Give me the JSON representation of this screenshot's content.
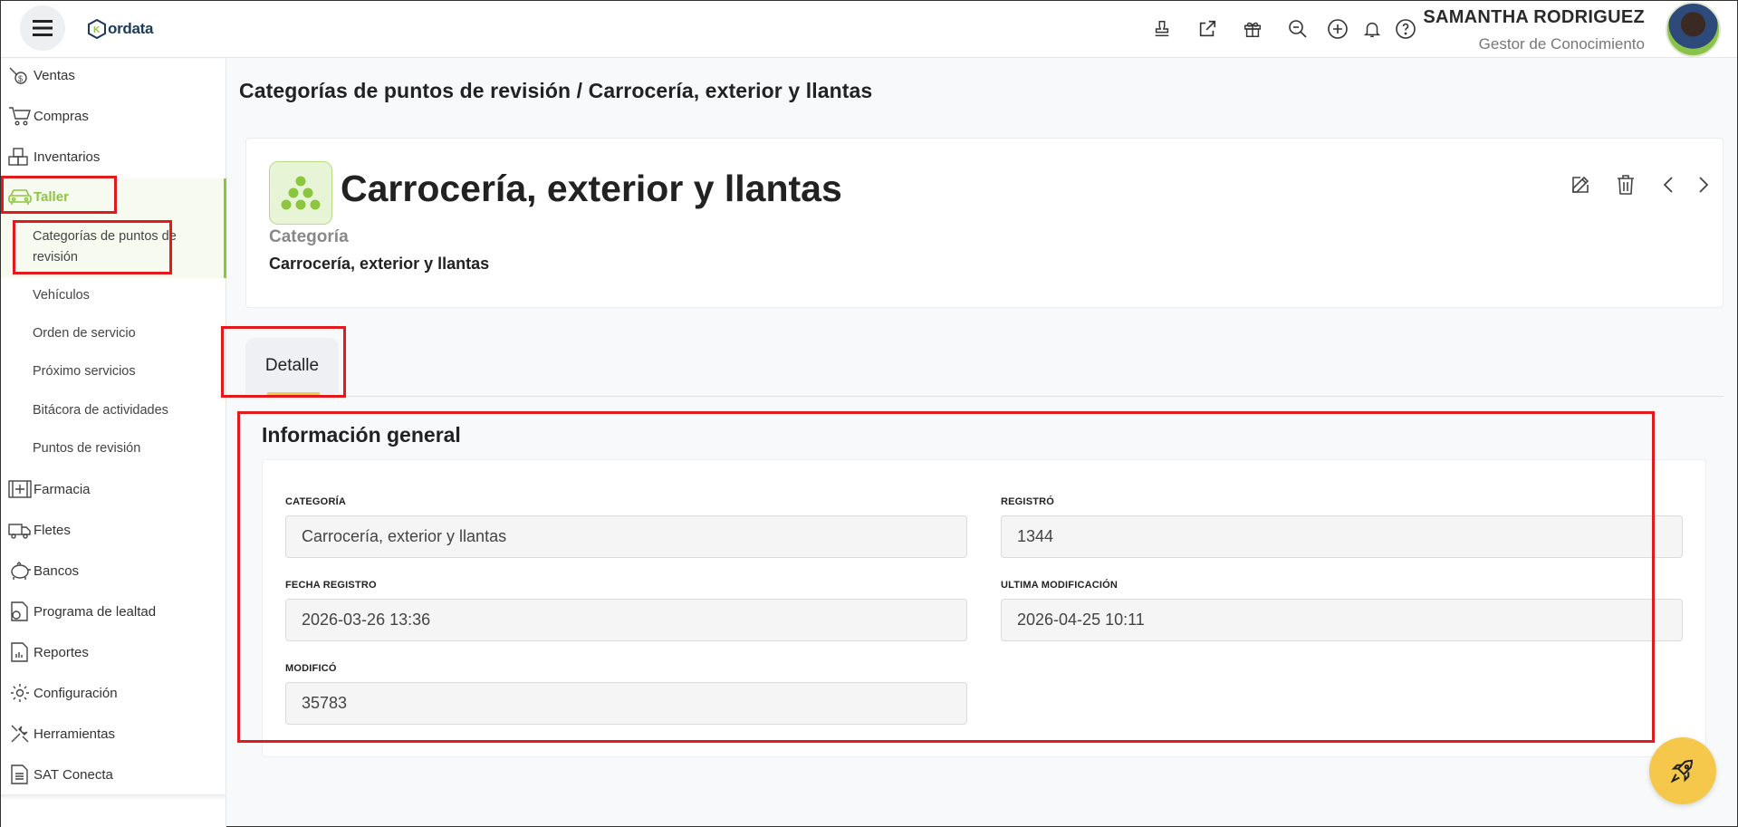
{
  "header": {
    "logo_text": "ordata",
    "logo_mark": "K",
    "user_name": "SAMANTHA RODRIGUEZ",
    "user_role": "Gestor de Conocimiento",
    "icons": [
      "stamp-icon",
      "external-link-icon",
      "gift-icon",
      "search-zoom-icon",
      "add-circle-icon",
      "bell-icon",
      "help-icon"
    ]
  },
  "sidebar": {
    "items": [
      {
        "label": "Ventas",
        "icon": "sales-icon"
      },
      {
        "label": "Compras",
        "icon": "cart-icon"
      },
      {
        "label": "Inventarios",
        "icon": "boxes-icon"
      },
      {
        "label": "Taller",
        "icon": "car-icon"
      },
      {
        "label": "Farmacia",
        "icon": "first-aid-icon"
      },
      {
        "label": "Fletes",
        "icon": "truck-icon"
      },
      {
        "label": "Bancos",
        "icon": "piggy-bank-icon"
      },
      {
        "label": "Programa de lealtad",
        "icon": "loyalty-icon"
      },
      {
        "label": "Reportes",
        "icon": "report-icon"
      },
      {
        "label": "Configuración",
        "icon": "gear-icon"
      },
      {
        "label": "Herramientas",
        "icon": "tools-icon"
      },
      {
        "label": "SAT Conecta",
        "icon": "document-icon"
      }
    ],
    "taller_sub": [
      {
        "label": "Categorías de puntos de revisión"
      },
      {
        "label": "Vehículos"
      },
      {
        "label": "Orden de servicio"
      },
      {
        "label": "Próximo servicios"
      },
      {
        "label": "Bitácora de actividades"
      },
      {
        "label": "Puntos de revisión"
      }
    ]
  },
  "main": {
    "breadcrumb": "Categorías de puntos de revisión /  Carrocería, exterior y llantas",
    "card": {
      "title": "Carrocería, exterior y llantas",
      "label": "Categoría",
      "value": "Carrocería, exterior y llantas"
    },
    "tabs": [
      {
        "label": "Detalle"
      }
    ],
    "section_title": "Información general",
    "fields": {
      "categoria": {
        "label": "CATEGORÍA",
        "value": "Carrocería, exterior y llantas"
      },
      "registro": {
        "label": "REGISTRÓ",
        "value": "1344"
      },
      "fecha_registro": {
        "label": "FECHA REGISTRO",
        "value": "2026-03-26 13:36"
      },
      "ultima_modificacion": {
        "label": "ULTIMA MODIFICACIÓN",
        "value": "2026-04-25 10:11"
      },
      "modifico": {
        "label": "MODIFICÓ",
        "value": "35783"
      }
    }
  },
  "colors": {
    "accent_green": "#8cc63f",
    "highlight_red": "#e11b1b",
    "fab_yellow": "#f5c84c"
  }
}
